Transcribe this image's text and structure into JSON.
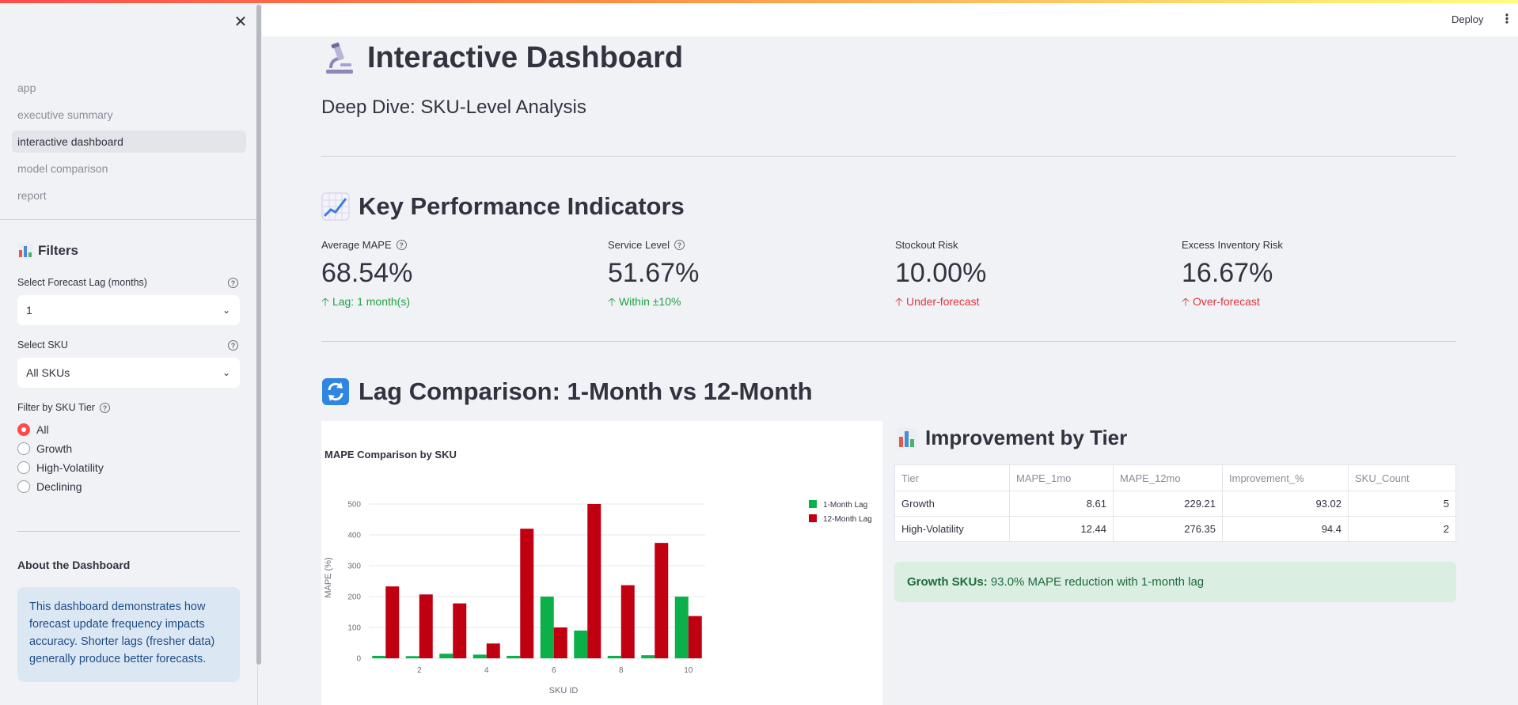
{
  "sidebar": {
    "nav": [
      {
        "label": "app",
        "active": false
      },
      {
        "label": "executive summary",
        "active": false
      },
      {
        "label": "interactive dashboard",
        "active": true
      },
      {
        "label": "model comparison",
        "active": false
      },
      {
        "label": "report",
        "active": false
      }
    ],
    "filters_title": "Filters",
    "lag_label": "Select Forecast Lag (months)",
    "lag_value": "1",
    "sku_label": "Select SKU",
    "sku_value": "All SKUs",
    "tier_label": "Filter by SKU Tier",
    "tier_options": [
      "All",
      "Growth",
      "High-Volatility",
      "Declining"
    ],
    "tier_selected": "All",
    "about_title": "About the Dashboard",
    "about_text": "This dashboard demonstrates how forecast update frequency impacts accuracy. Shorter lags (fresher data) generally produce better forecasts."
  },
  "topbar": {
    "deploy": "Deploy"
  },
  "header": {
    "title": "Interactive Dashboard",
    "subtitle": "Deep Dive: SKU-Level Analysis"
  },
  "kpi": {
    "title": "Key Performance Indicators",
    "metrics": [
      {
        "label": "Average MAPE",
        "value": "68.54%",
        "delta": "Lag: 1 month(s)"
      },
      {
        "label": "Service Level",
        "value": "51.67%",
        "delta": "Within ±10%"
      },
      {
        "label": "Stockout Risk",
        "value": "10.00%",
        "delta": "Under-forecast"
      },
      {
        "label": "Excess Inventory Risk",
        "value": "16.67%",
        "delta": "Over-forecast"
      }
    ]
  },
  "lag": {
    "title": "Lag Comparison: 1-Month vs 12-Month"
  },
  "tier_section": {
    "title": "Improvement by Tier",
    "columns": [
      "Tier",
      "MAPE_1mo",
      "MAPE_12mo",
      "Improvement_%",
      "SKU_Count"
    ],
    "rows": [
      [
        "Growth",
        "8.61",
        "229.21",
        "93.02",
        "5"
      ],
      [
        "High-Volatility",
        "12.44",
        "276.35",
        "94.4",
        "2"
      ]
    ],
    "success_bold": "Growth SKUs:",
    "success_text": " 93.0% MAPE reduction with 1-month lag"
  },
  "chart_data": {
    "type": "bar",
    "title": "MAPE Comparison by SKU",
    "xlabel": "SKU ID",
    "ylabel": "MAPE (%)",
    "x": [
      1,
      2,
      3,
      4,
      5,
      6,
      7,
      8,
      9,
      10
    ],
    "xticks": [
      "2",
      "4",
      "6",
      "8",
      "10"
    ],
    "yticks": [
      "0",
      "100",
      "200",
      "300",
      "400",
      "500"
    ],
    "ylim": [
      0,
      500
    ],
    "legend_position": "top-right",
    "colors": {
      "lag1": "#0cb04a",
      "lag12": "#c00010"
    },
    "series": [
      {
        "name": "1-Month Lag",
        "values": [
          8,
          7,
          15,
          12,
          8,
          200,
          90,
          8,
          10,
          200
        ]
      },
      {
        "name": "12-Month Lag",
        "values": [
          233,
          207,
          178,
          48,
          420,
          100,
          500,
          237,
          374,
          137
        ]
      }
    ]
  }
}
